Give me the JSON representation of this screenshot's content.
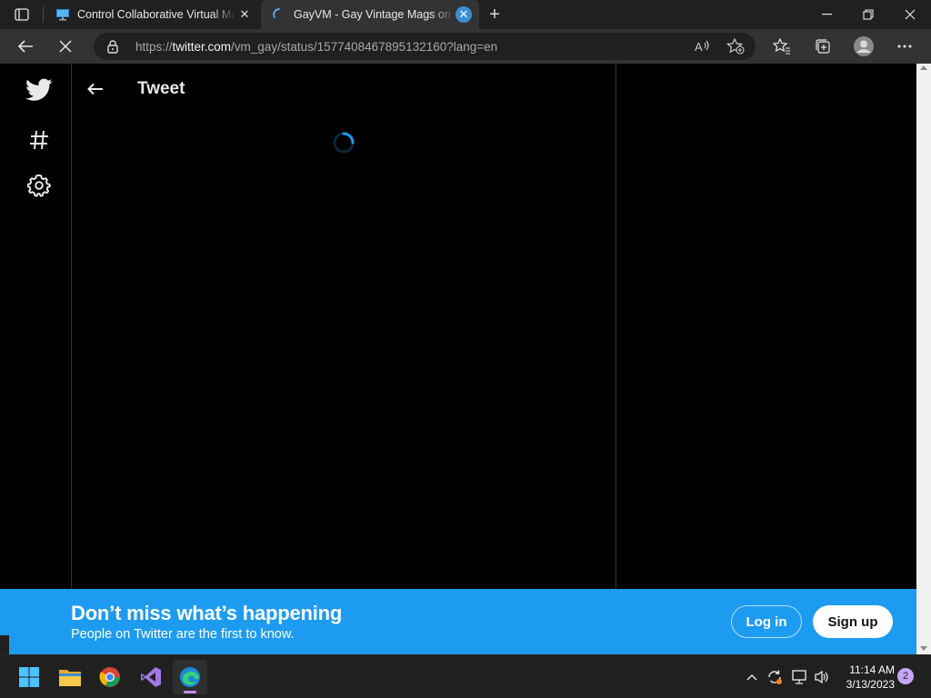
{
  "browser": {
    "tabs": [
      {
        "title": "Control Collaborative Virtual Machine",
        "favicon": "monitor-icon",
        "active": false
      },
      {
        "title": "GayVM - Gay Vintage Mags on Twitter",
        "favicon": "loading-spinner-icon",
        "active": true
      }
    ],
    "address": {
      "scheme": "https://",
      "host": "twitter.com",
      "path": "/vm_gay/status/1577408467895132160?lang=en"
    }
  },
  "twitter": {
    "header_title": "Tweet",
    "nav_icons": [
      "twitter-bird-icon",
      "hashtag-icon",
      "settings-icon"
    ],
    "banner": {
      "title": "Don’t miss what’s happening",
      "subtitle": "People on Twitter are the first to know.",
      "login_label": "Log in",
      "signup_label": "Sign up"
    },
    "colors": {
      "accent": "#1d9bf0",
      "background": "#000000"
    }
  },
  "taskbar": {
    "apps": [
      "windows-start-icon",
      "file-explorer-icon",
      "chrome-icon",
      "visual-studio-icon",
      "edge-icon"
    ],
    "time": "11:14 AM",
    "date": "3/13/2023",
    "notification_count": "2"
  }
}
